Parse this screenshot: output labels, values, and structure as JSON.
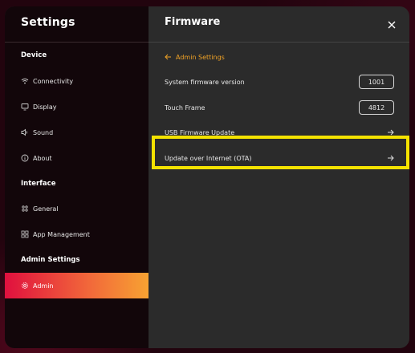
{
  "sidebar": {
    "title": "Settings",
    "sections": [
      {
        "label": "Device"
      },
      {
        "label": "Interface"
      },
      {
        "label": "Admin Settings"
      }
    ],
    "items": [
      {
        "label": "Connectivity",
        "icon": "wifi-icon"
      },
      {
        "label": "Display",
        "icon": "monitor-icon"
      },
      {
        "label": "Sound",
        "icon": "speaker-icon"
      },
      {
        "label": "About",
        "icon": "info-icon"
      },
      {
        "label": "General",
        "icon": "grid-dots-icon"
      },
      {
        "label": "App Management",
        "icon": "apps-icon"
      },
      {
        "label": "Admin",
        "icon": "gear-icon",
        "active": true
      }
    ]
  },
  "main": {
    "title": "Firmware",
    "breadcrumb": "Admin Settings",
    "rows": [
      {
        "label": "System firmware version",
        "value": "1001"
      },
      {
        "label": "Touch Frame",
        "value": "4812"
      },
      {
        "label": "USB Firmware Update"
      },
      {
        "label": "Update over Internet (OTA)",
        "highlighted": true
      }
    ]
  },
  "colors": {
    "accent": "#f0a226",
    "active_gradient_start": "#e0103e",
    "active_gradient_end": "#f7a232",
    "highlight": "#f4e200"
  }
}
